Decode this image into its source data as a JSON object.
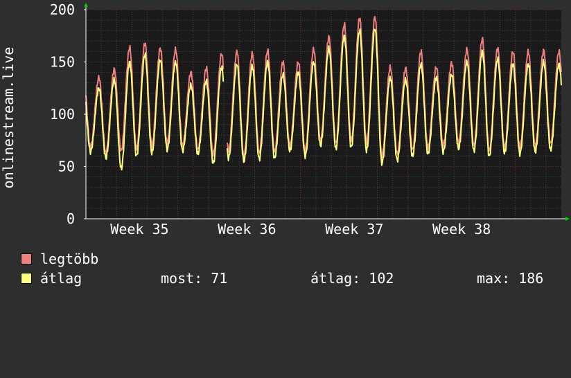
{
  "chart_data": {
    "type": "line",
    "title": "",
    "ylabel": "onlinestream.live",
    "xlabel": "",
    "ylim": [
      0,
      200
    ],
    "yticks": [
      "0",
      "50",
      "100",
      "150",
      "200"
    ],
    "xtick_labels": [
      "Week 35",
      "Week 36",
      "Week 37",
      "Week 38"
    ],
    "grid": true,
    "x_unit": "day",
    "x_range": [
      0,
      31
    ],
    "x_label_positions": [
      3.5,
      10.5,
      17.5,
      24.5
    ],
    "peak_time": 0.85,
    "trough_time": 0.3,
    "series": [
      {
        "name": "legtöbb",
        "color": "#f08080",
        "daily_peaks": [
          135,
          143,
          164,
          168,
          163,
          162,
          140,
          144,
          158,
          160,
          158,
          161,
          150,
          150,
          162,
          174,
          186,
          192,
          193,
          145,
          144,
          160,
          145,
          149,
          162,
          172,
          163,
          160,
          160,
          161,
          160
        ],
        "daily_troughs": [
          68,
          63,
          65,
          67,
          70,
          72,
          70,
          66,
          62,
          65,
          60,
          63,
          64,
          70,
          65,
          75,
          72,
          75,
          73,
          60,
          62,
          66,
          68,
          70,
          73,
          70,
          65,
          68,
          68,
          70,
          72
        ]
      },
      {
        "name": "átlag",
        "color": "#ffff80",
        "daily_peaks": [
          125,
          133,
          150,
          157,
          152,
          150,
          128,
          132,
          145,
          148,
          146,
          150,
          138,
          140,
          150,
          163,
          175,
          180,
          182,
          135,
          133,
          148,
          135,
          138,
          150,
          160,
          153,
          148,
          148,
          150,
          148
        ],
        "daily_troughs": [
          64,
          58,
          48,
          60,
          63,
          66,
          65,
          62,
          53,
          58,
          55,
          57,
          58,
          65,
          60,
          70,
          67,
          68,
          65,
          53,
          56,
          60,
          62,
          64,
          67,
          65,
          60,
          63,
          62,
          64,
          66
        ]
      }
    ],
    "gap_days": [
      9
    ]
  },
  "legend": {
    "max_label": "legtöbb",
    "avg_label": "átlag",
    "max_color": "#f08080",
    "avg_color": "#ffff80"
  },
  "stats": {
    "now": "most: 71",
    "average": "átlag: 102",
    "maximum": "max: 186"
  },
  "colors": {
    "background": "#2e2e2e",
    "plot_background": "#1a1a1a",
    "grid_minor": "#444444",
    "grid_major": "#7a2a2a",
    "axis_arrow": "#00cc00"
  }
}
